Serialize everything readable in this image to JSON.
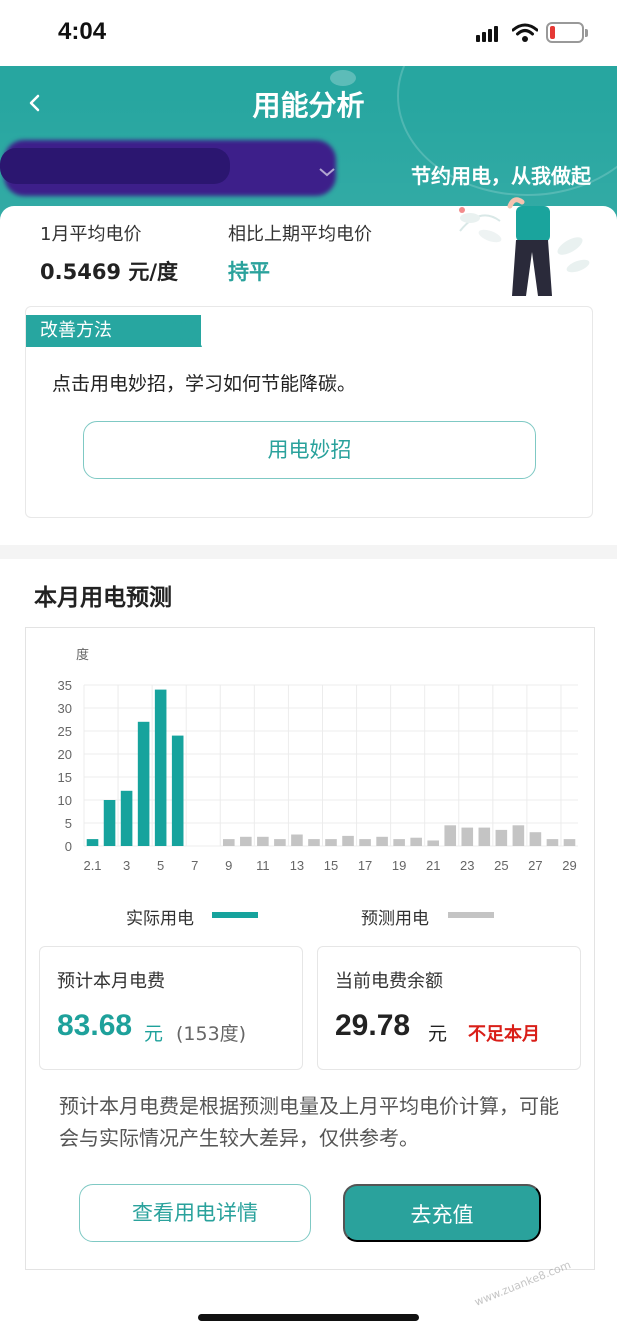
{
  "status_bar": {
    "time": "4:04"
  },
  "header": {
    "title": "用能分析",
    "back_icon": "chevron-left-icon",
    "slogan": "节约用电，从我做起",
    "dropdown_icon": "chevron-down-icon"
  },
  "price": {
    "avg_label": "1月平均电价",
    "avg_value": "0.5469 元/度",
    "compare_label": "相比上期平均电价",
    "compare_value": "持平"
  },
  "improve": {
    "tag": "改善方法",
    "text": "点击用电妙招，学习如何节能降碳。",
    "button": "用电妙招"
  },
  "forecast": {
    "title": "本月用电预测",
    "legend_actual": "实际用电",
    "legend_predicted": "预测用电",
    "est_bill_label": "预计本月电费",
    "est_bill_value": "83.68",
    "est_bill_unit": "元",
    "est_bill_kwh": "(153度)",
    "balance_label": "当前电费余额",
    "balance_value": "29.78",
    "balance_unit": "元",
    "balance_warning": "不足本月",
    "note": "预计本月电费是根据预测电量及上月平均电价计算，可能会与实际情况产生较大差异，仅供参考。",
    "detail_button": "查看用电详情",
    "recharge_button": "去充值"
  },
  "colors": {
    "brand": "#27a6a0",
    "actual_bar": "#16a39d",
    "predicted_bar": "#c4c4c4",
    "warning": "#d91e18"
  },
  "chart_data": {
    "type": "bar",
    "ylabel": "度",
    "ylim": [
      0,
      35
    ],
    "yticks": [
      0,
      5,
      10,
      15,
      20,
      25,
      30,
      35
    ],
    "x_tick_labels": [
      "2.1",
      "3",
      "5",
      "7",
      "9",
      "11",
      "13",
      "15",
      "17",
      "19",
      "21",
      "23",
      "25",
      "27",
      "29"
    ],
    "x": [
      1,
      2,
      3,
      4,
      5,
      6,
      7,
      8,
      9,
      10,
      11,
      12,
      13,
      14,
      15,
      16,
      17,
      18,
      19,
      20,
      21,
      22,
      23,
      24,
      25,
      26,
      27,
      28,
      29
    ],
    "series": [
      {
        "name": "实际用电",
        "values": [
          1.5,
          10,
          12,
          27,
          34,
          24,
          0,
          0,
          0,
          0,
          0,
          0,
          0,
          0,
          0,
          0,
          0,
          0,
          0,
          0,
          0,
          0,
          0,
          0,
          0,
          0,
          0,
          0,
          0
        ]
      },
      {
        "name": "预测用电",
        "values": [
          0,
          0,
          0,
          0,
          0,
          0,
          0,
          0,
          1.5,
          2,
          2,
          1.5,
          2.5,
          1.5,
          1.5,
          2.2,
          1.5,
          2,
          1.5,
          1.8,
          1.2,
          4.5,
          4,
          4,
          3.5,
          4.5,
          3,
          1.5,
          1.5
        ]
      }
    ]
  }
}
